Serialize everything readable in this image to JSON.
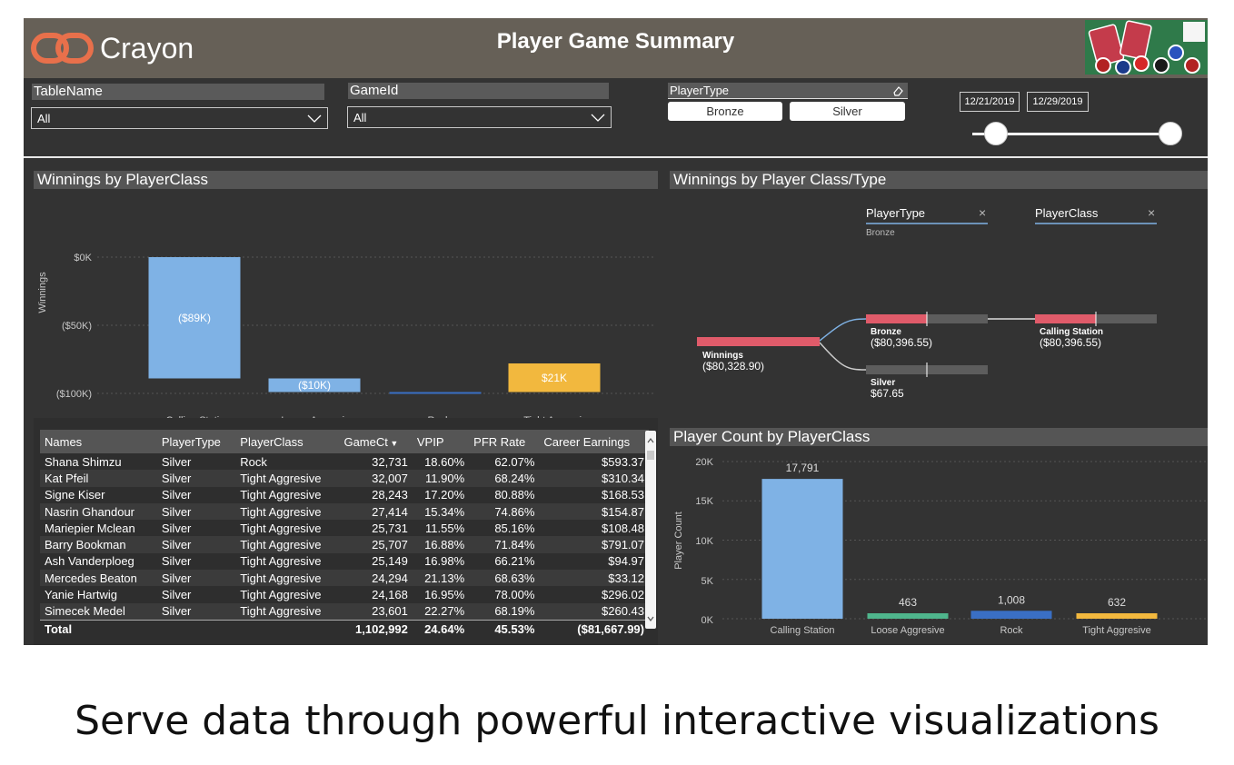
{
  "brand": {
    "name": "Crayon",
    "accent": "#e8704b"
  },
  "header": {
    "title": "Player Game Summary",
    "image": "playing-cards-and-chips"
  },
  "filters": {
    "table_name": {
      "label": "TableName",
      "value": "All"
    },
    "game_id": {
      "label": "GameId",
      "value": "All"
    },
    "player_type": {
      "label": "PlayerType",
      "options": [
        "Bronze",
        "Silver"
      ]
    },
    "date_range": {
      "start": "12/21/2019",
      "end": "12/29/2019"
    }
  },
  "waterfall": {
    "title": "Winnings by PlayerClass",
    "ylabel": "Winnings",
    "yticks": [
      "$0K",
      "($50K)",
      "($100K)"
    ]
  },
  "decomp": {
    "title": "Winnings by Player Class/Type",
    "levels": [
      {
        "name": "PlayerType",
        "selected": "Bronze"
      },
      {
        "name": "PlayerClass"
      }
    ],
    "root": {
      "label": "Winnings",
      "value": "($80,328.90)"
    },
    "nodes": [
      {
        "label": "Bronze",
        "value": "($80,396.55)"
      },
      {
        "label": "Silver",
        "value": "$67.65"
      },
      {
        "label": "Calling Station",
        "value": "($80,396.55)"
      }
    ]
  },
  "table": {
    "headers": [
      "Names",
      "PlayerType",
      "PlayerClass",
      "GameCt",
      "VPIP",
      "PFR Rate",
      "Career Earnings"
    ],
    "rows": [
      [
        "Shana Shimzu",
        "Silver",
        "Rock",
        "32,731",
        "18.60%",
        "62.07%",
        "$593.37"
      ],
      [
        "Kat Pfeil",
        "Silver",
        "Tight Aggresive",
        "32,007",
        "11.90%",
        "68.24%",
        "$310.34"
      ],
      [
        "Signe Kiser",
        "Silver",
        "Tight Aggresive",
        "28,243",
        "17.20%",
        "80.88%",
        "$168.53"
      ],
      [
        "Nasrin Ghandour",
        "Silver",
        "Tight Aggresive",
        "27,414",
        "15.34%",
        "74.86%",
        "$154.87"
      ],
      [
        "Mariepier Mclean",
        "Silver",
        "Tight Aggresive",
        "25,731",
        "11.55%",
        "85.16%",
        "$108.48"
      ],
      [
        "Barry Bookman",
        "Silver",
        "Tight Aggresive",
        "25,707",
        "16.88%",
        "71.84%",
        "$791.07"
      ],
      [
        "Ash Vanderploeg",
        "Silver",
        "Tight Aggresive",
        "25,149",
        "16.98%",
        "66.21%",
        "$94.97"
      ],
      [
        "Mercedes Beaton",
        "Silver",
        "Tight Aggresive",
        "24,294",
        "21.13%",
        "68.63%",
        "$33.12"
      ],
      [
        "Yanie Hartwig",
        "Silver",
        "Tight Aggresive",
        "24,168",
        "16.95%",
        "78.00%",
        "$296.02"
      ],
      [
        "Simecek Medel",
        "Silver",
        "Tight Aggresive",
        "23,601",
        "22.27%",
        "68.19%",
        "$260.43"
      ]
    ],
    "total": [
      "Total",
      "",
      "",
      "1,102,992",
      "24.64%",
      "45.53%",
      "($81,667.99)"
    ]
  },
  "count_chart": {
    "title": "Player Count by PlayerClass",
    "ylabel": "Player Count",
    "yticks": [
      "20K",
      "15K",
      "10K",
      "5K",
      "0K"
    ]
  },
  "tagline": "Serve data through powerful interactive visualizations",
  "chart_data": [
    {
      "type": "bar",
      "subtype": "waterfall",
      "title": "Winnings by PlayerClass",
      "ylabel": "Winnings",
      "categories": [
        "Calling Station",
        "Loose Aggresive",
        "Rock",
        "Tight Aggresive"
      ],
      "values": [
        -89000,
        -10000,
        0,
        21000
      ],
      "data_labels": [
        "($89K)",
        "($10K)",
        "",
        "$21K"
      ],
      "colors": [
        "#7fb2e5",
        "#7fb2e5",
        "#3a6fc4",
        "#f2b83e"
      ],
      "ylim": [
        -100000,
        10000
      ],
      "grid": true
    },
    {
      "type": "bar",
      "title": "Player Count by PlayerClass",
      "ylabel": "Player Count",
      "categories": [
        "Calling Station",
        "Loose Aggresive",
        "Rock",
        "Tight Aggresive"
      ],
      "values": [
        17791,
        463,
        1008,
        632
      ],
      "data_labels": [
        "17,791",
        "463",
        "1,008",
        "632"
      ],
      "colors": [
        "#7fb2e5",
        "#4fb58c",
        "#3a6fc4",
        "#f2b83e"
      ],
      "ylim": [
        0,
        20000
      ],
      "grid": true
    }
  ]
}
